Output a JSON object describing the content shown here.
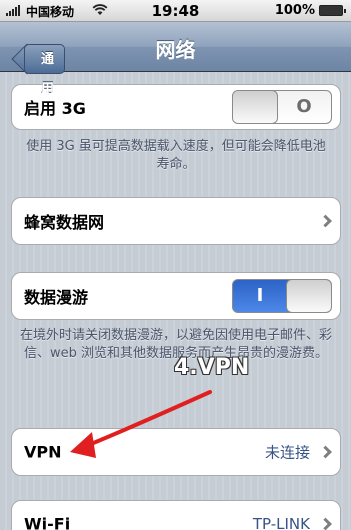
{
  "status_bar": {
    "carrier": "中国移动",
    "time": "19:48",
    "battery_percent": "100%",
    "battery_level": 1.0
  },
  "nav": {
    "back_label": "通用",
    "title": "网络"
  },
  "enable_3g": {
    "label": "启用 3G",
    "switch_state": "O",
    "is_on": false
  },
  "enable_3g_footer": "使用 3G 虽可提高数据载入速度，但可能会降低电池寿命。",
  "cellular_data": {
    "label": "蜂窝数据网"
  },
  "data_roaming": {
    "label": "数据漫游",
    "switch_state": "I",
    "is_on": true
  },
  "data_roaming_footer": "在境外时请关闭数据漫游，以避免因使用电子邮件、彩信、web 浏览和其他数据服务而产生昂贵的漫游费。",
  "vpn": {
    "label": "VPN",
    "status": "未连接"
  },
  "wifi": {
    "label": "Wi-Fi",
    "network": "TP-LINK"
  },
  "annotation": {
    "text": "4.VPN",
    "color": "#e02020"
  },
  "colors": {
    "nav_bar": "#7e94b1",
    "background": "#c5ccd4",
    "switch_on": "#3a76d9",
    "detail_text": "#385487"
  }
}
